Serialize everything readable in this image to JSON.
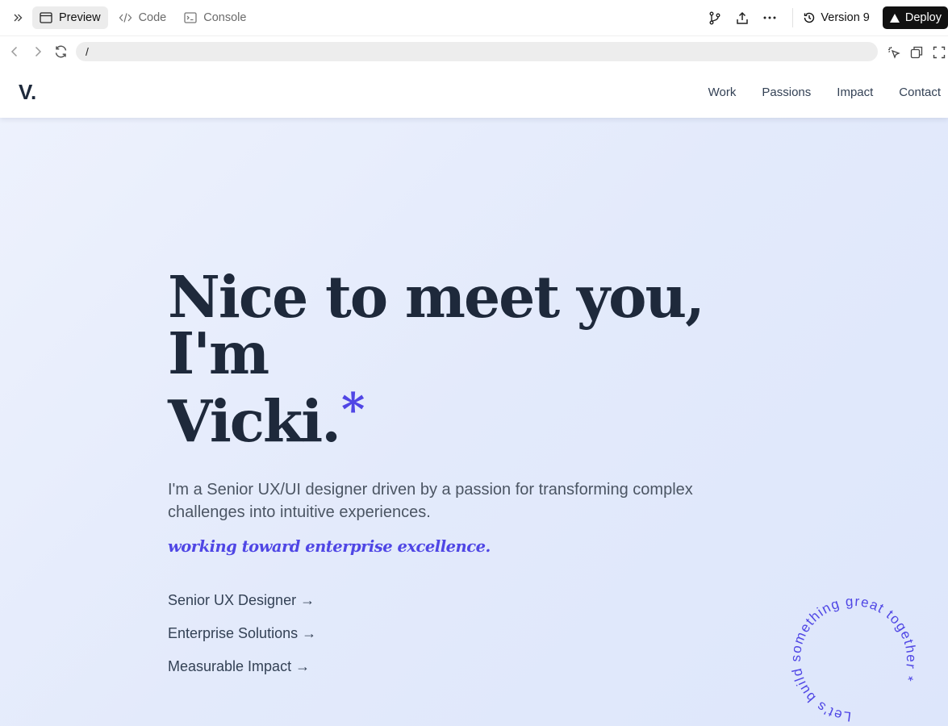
{
  "toolbar": {
    "tabs": [
      {
        "label": "Preview",
        "icon": "browser-window-icon",
        "active": true
      },
      {
        "label": "Code",
        "icon": "code-icon",
        "active": false
      },
      {
        "label": "Console",
        "icon": "terminal-icon",
        "active": false
      }
    ],
    "version_label": "Version 9",
    "deploy_label": "Deploy"
  },
  "address_bar": {
    "url": "/"
  },
  "site": {
    "logo": "V.",
    "nav": [
      "Work",
      "Passions",
      "Impact",
      "Contact"
    ],
    "hero": {
      "title_line1": "Nice to meet you, I'm",
      "title_line2": "Vicki.",
      "title_star": "*",
      "description": "I'm a Senior UX/UI designer driven by a passion for transforming complex challenges into intuitive experiences.",
      "tagline": "working toward enterprise excellence.",
      "links": [
        "Senior UX Designer →",
        "Enterprise Solutions →",
        "Measurable Impact →"
      ]
    },
    "circular_text": "Let's build something great together *"
  },
  "colors": {
    "accent": "#4f46e5",
    "heading": "#1e293b",
    "body_text": "#4b5563",
    "hero_bg_start": "#eef2fd",
    "hero_bg_end": "#dde6fb",
    "deploy_bg": "#111111"
  }
}
